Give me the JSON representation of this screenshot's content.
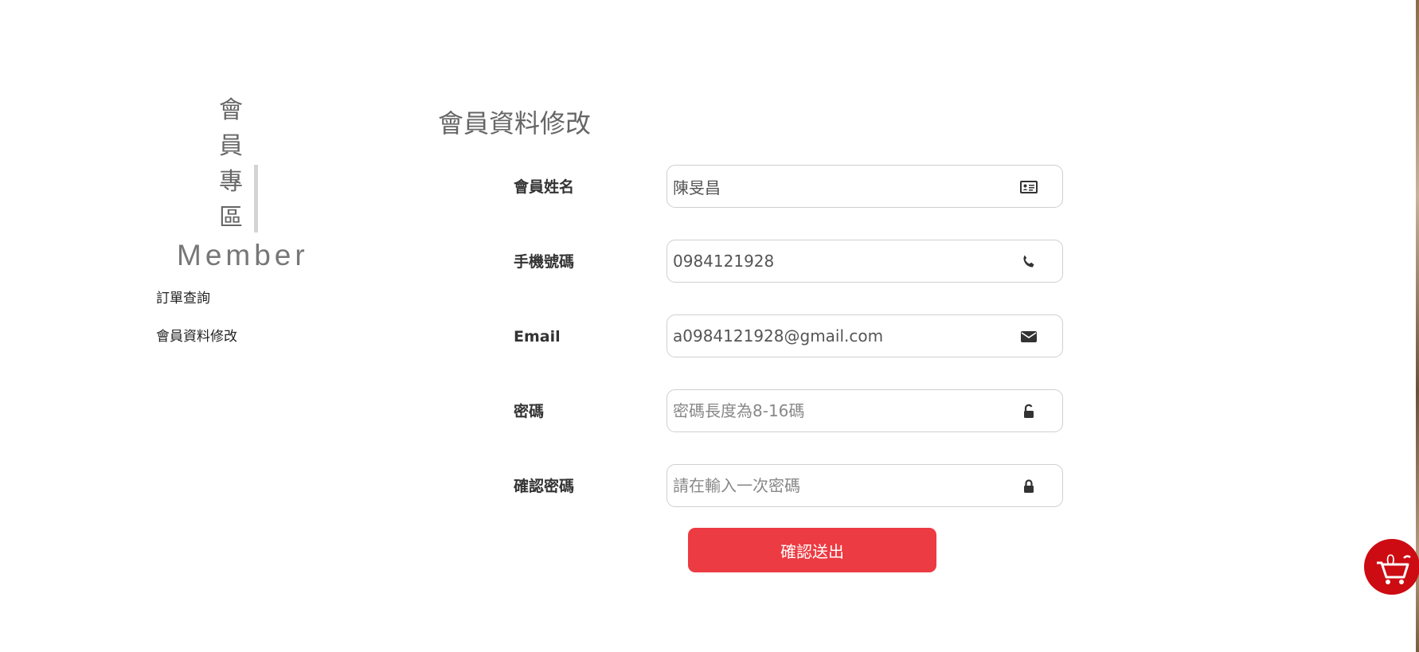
{
  "sidebar": {
    "title_chars": [
      "會",
      "員",
      "專",
      "區"
    ],
    "subtitle": "Member",
    "menu": [
      {
        "label": "訂單查詢"
      },
      {
        "label": "會員資料修改"
      }
    ]
  },
  "main": {
    "title": "會員資料修改",
    "fields": [
      {
        "label": "會員姓名",
        "value": "陳旻昌",
        "placeholder": "",
        "icon": "id-card-icon"
      },
      {
        "label": "手機號碼",
        "value": "0984121928",
        "placeholder": "",
        "icon": "phone-icon"
      },
      {
        "label": "Email",
        "value": "a0984121928@gmail.com",
        "placeholder": "",
        "icon": "envelope-icon"
      },
      {
        "label": "密碼",
        "value": "",
        "placeholder": "密碼長度為8-16碼",
        "icon": "unlock-icon"
      },
      {
        "label": "確認密碼",
        "value": "",
        "placeholder": "請在輸入一次密碼",
        "icon": "lock-icon"
      }
    ],
    "submit_label": "確認送出"
  },
  "cart": {
    "count": "0"
  },
  "colors": {
    "accent": "#ec3b42",
    "cart": "#cc0b12",
    "sidebar_bar": "#d4d4d4"
  }
}
